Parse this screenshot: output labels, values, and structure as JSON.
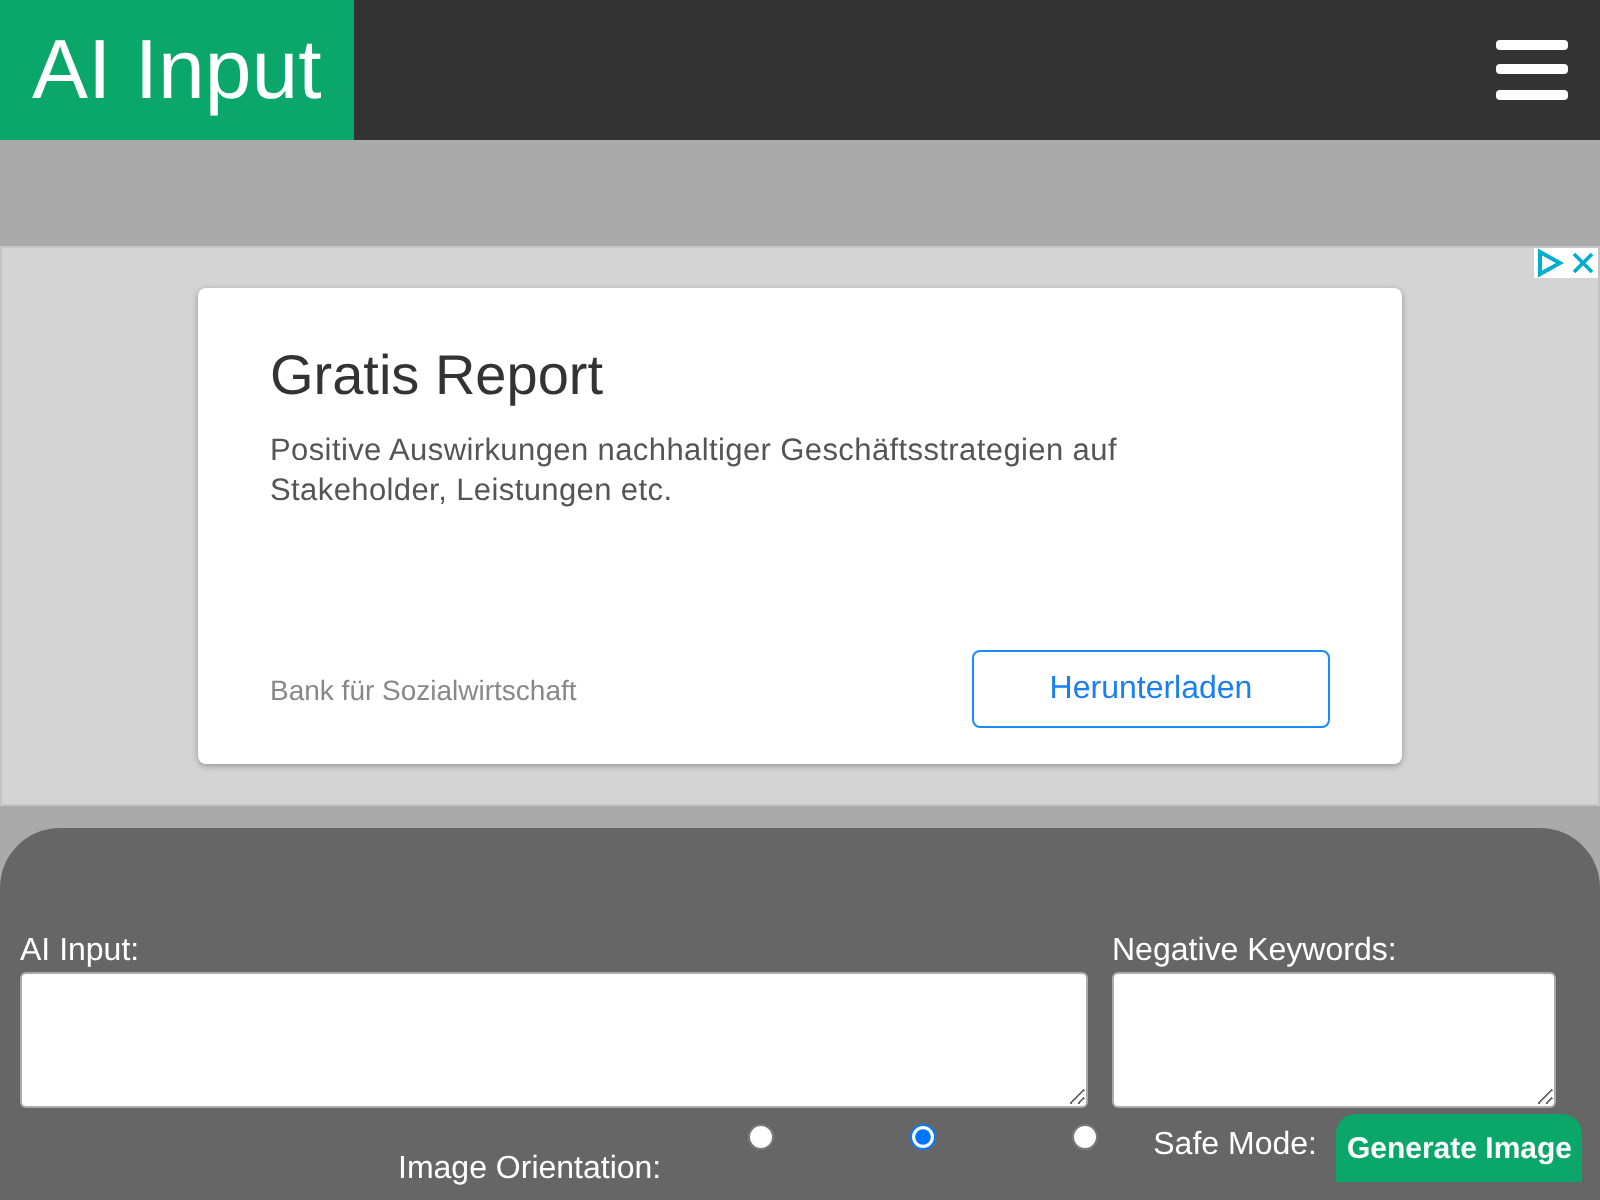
{
  "header": {
    "logo": "AI Input"
  },
  "ad": {
    "title": "Gratis Report",
    "text": "Positive Auswirkungen nachhaltiger Geschäftsstrategien auf Stakeholder, Leistungen etc.",
    "advertiser": "Bank für Sozialwirtschaft",
    "button": "Herunterladen"
  },
  "form": {
    "ai_input_label": "AI Input:",
    "negative_label": "Negative Keywords:",
    "orientation_label": "Image Orientation:",
    "orientations": [
      {
        "selected": false
      },
      {
        "selected": true
      },
      {
        "selected": false
      }
    ],
    "safe_mode_label": "Safe Mode:",
    "generate_button": "Generate Image"
  }
}
